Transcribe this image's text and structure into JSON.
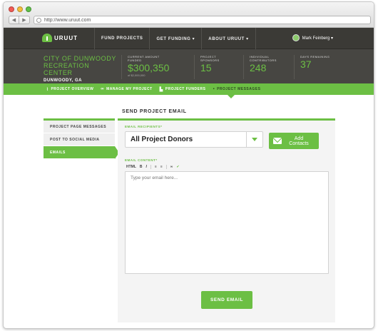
{
  "browser": {
    "url": "http://www.uruut.com"
  },
  "topnav": {
    "logo_text": "URUUT",
    "items": [
      "FUND PROJECTS",
      "GET FUNDING ▾",
      "ABOUT URUUT ▾"
    ],
    "user_name": "Mark Feinberg ▾"
  },
  "project": {
    "name": "City of Dunwoody Recreation Center",
    "location": "DUNWOODY, GA",
    "stats": [
      {
        "label": "Current Amount Funded",
        "value": "$300,350",
        "sub": "of $2,000,000"
      },
      {
        "label": "Project Sponsors",
        "value": "15",
        "sub": ""
      },
      {
        "label": "Individual Contributors",
        "value": "248",
        "sub": ""
      },
      {
        "label": "Days Remaining",
        "value": "37",
        "sub": ""
      }
    ]
  },
  "tabs": [
    {
      "label": "PROJECT OVERVIEW",
      "icon": "chart-icon"
    },
    {
      "label": "MANAGE MY PROJECT",
      "icon": "link-icon"
    },
    {
      "label": "PROJECT FUNDERS",
      "icon": "bars-icon"
    },
    {
      "label": "PROJECT MESSAGES",
      "icon": "chat-icon"
    }
  ],
  "sidebar": {
    "items": [
      "Project Page Messages",
      "Post to Social Media",
      "Emails"
    ],
    "active_index": 2
  },
  "form": {
    "title": "Send Project Email",
    "recipients_label": "Email Recipients*",
    "recipients_value": "All Project Donors",
    "add_contacts_label": "Add Contacts",
    "content_label": "Email Content*",
    "toolbar": [
      "HTML",
      "B",
      "I",
      "≡",
      "≡",
      "∞",
      "✔"
    ],
    "content_placeholder": "Type your email here...",
    "send_label": "Send Email"
  },
  "colors": {
    "brand_green": "#6cbf44",
    "nav_dark": "#3b3a36",
    "header_dark": "#474642"
  }
}
